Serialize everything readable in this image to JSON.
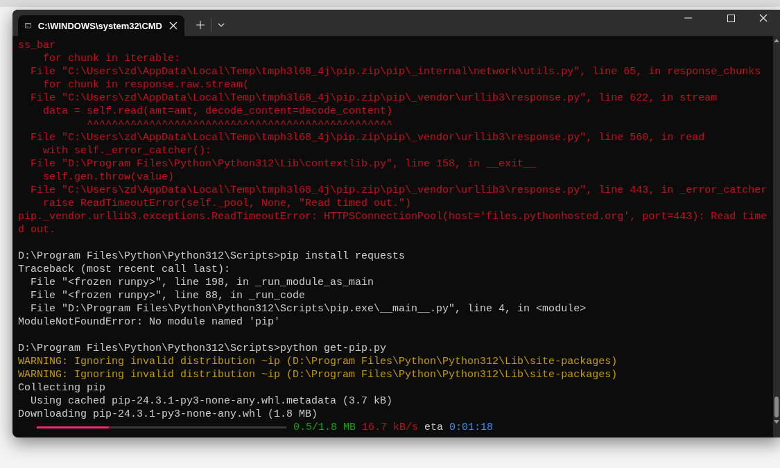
{
  "window": {
    "title": "C:\\WINDOWS\\system32\\CMD"
  },
  "terminal": {
    "lines": [
      {
        "kind": "error",
        "text": "ss_bar"
      },
      {
        "kind": "error",
        "text": "    for chunk in iterable:"
      },
      {
        "kind": "error",
        "text": "  File \"C:\\Users\\zd\\AppData\\Local\\Temp\\tmph3l68_4j\\pip.zip\\pip\\_internal\\network\\utils.py\", line 65, in response_chunks"
      },
      {
        "kind": "error",
        "text": "    for chunk in response.raw.stream("
      },
      {
        "kind": "error",
        "text": "  File \"C:\\Users\\zd\\AppData\\Local\\Temp\\tmph3l68_4j\\pip.zip\\pip\\_vendor\\urllib3\\response.py\", line 622, in stream"
      },
      {
        "kind": "error",
        "text": "    data = self.read(amt=amt, decode_content=decode_content)"
      },
      {
        "kind": "error",
        "text": "           ^^^^^^^^^^^^^^^^^^^^^^^^^^^^^^^^^^^^^^^^^^^^^^^^^"
      },
      {
        "kind": "error",
        "text": "  File \"C:\\Users\\zd\\AppData\\Local\\Temp\\tmph3l68_4j\\pip.zip\\pip\\_vendor\\urllib3\\response.py\", line 560, in read"
      },
      {
        "kind": "error",
        "text": "    with self._error_catcher():"
      },
      {
        "kind": "error",
        "text": "  File \"D:\\Program Files\\Python\\Python312\\Lib\\contextlib.py\", line 158, in __exit__"
      },
      {
        "kind": "error",
        "text": "    self.gen.throw(value)"
      },
      {
        "kind": "error",
        "text": "  File \"C:\\Users\\zd\\AppData\\Local\\Temp\\tmph3l68_4j\\pip.zip\\pip\\_vendor\\urllib3\\response.py\", line 443, in _error_catcher"
      },
      {
        "kind": "error",
        "text": "    raise ReadTimeoutError(self._pool, None, \"Read timed out.\")"
      },
      {
        "kind": "error",
        "text": "pip._vendor.urllib3.exceptions.ReadTimeoutError: HTTPSConnectionPool(host='files.pythonhosted.org', port=443): Read time"
      },
      {
        "kind": "error",
        "text": "d out."
      },
      {
        "kind": "blank"
      },
      {
        "kind": "normal",
        "text": "D:\\Program Files\\Python\\Python312\\Scripts>pip install requests"
      },
      {
        "kind": "normal",
        "text": "Traceback (most recent call last):"
      },
      {
        "kind": "normal",
        "text": "  File \"<frozen runpy>\", line 198, in _run_module_as_main"
      },
      {
        "kind": "normal",
        "text": "  File \"<frozen runpy>\", line 88, in _run_code"
      },
      {
        "kind": "normal",
        "text": "  File \"D:\\Program Files\\Python\\Python312\\Scripts\\pip.exe\\__main__.py\", line 4, in <module>"
      },
      {
        "kind": "normal",
        "text": "ModuleNotFoundError: No module named 'pip'"
      },
      {
        "kind": "blank"
      },
      {
        "kind": "normal",
        "text": "D:\\Program Files\\Python\\Python312\\Scripts>python get-pip.py"
      },
      {
        "kind": "warning",
        "text": "WARNING: Ignoring invalid distribution ~ip (D:\\Program Files\\Python\\Python312\\Lib\\site-packages)"
      },
      {
        "kind": "warning",
        "text": "WARNING: Ignoring invalid distribution ~ip (D:\\Program Files\\Python\\Python312\\Lib\\site-packages)"
      },
      {
        "kind": "normal",
        "text": "Collecting pip"
      },
      {
        "kind": "normal",
        "text": "  Using cached pip-24.3.1-py3-none-any.whl.metadata (3.7 kB)"
      },
      {
        "kind": "normal",
        "text": "Downloading pip-24.3.1-py3-none-any.whl (1.8 MB)"
      }
    ],
    "progress": {
      "level": 0.29,
      "downloaded": "0.5/1.8 MB",
      "speed": "16.7 kB/s",
      "eta_label": "eta",
      "eta": "0:01:18"
    }
  }
}
